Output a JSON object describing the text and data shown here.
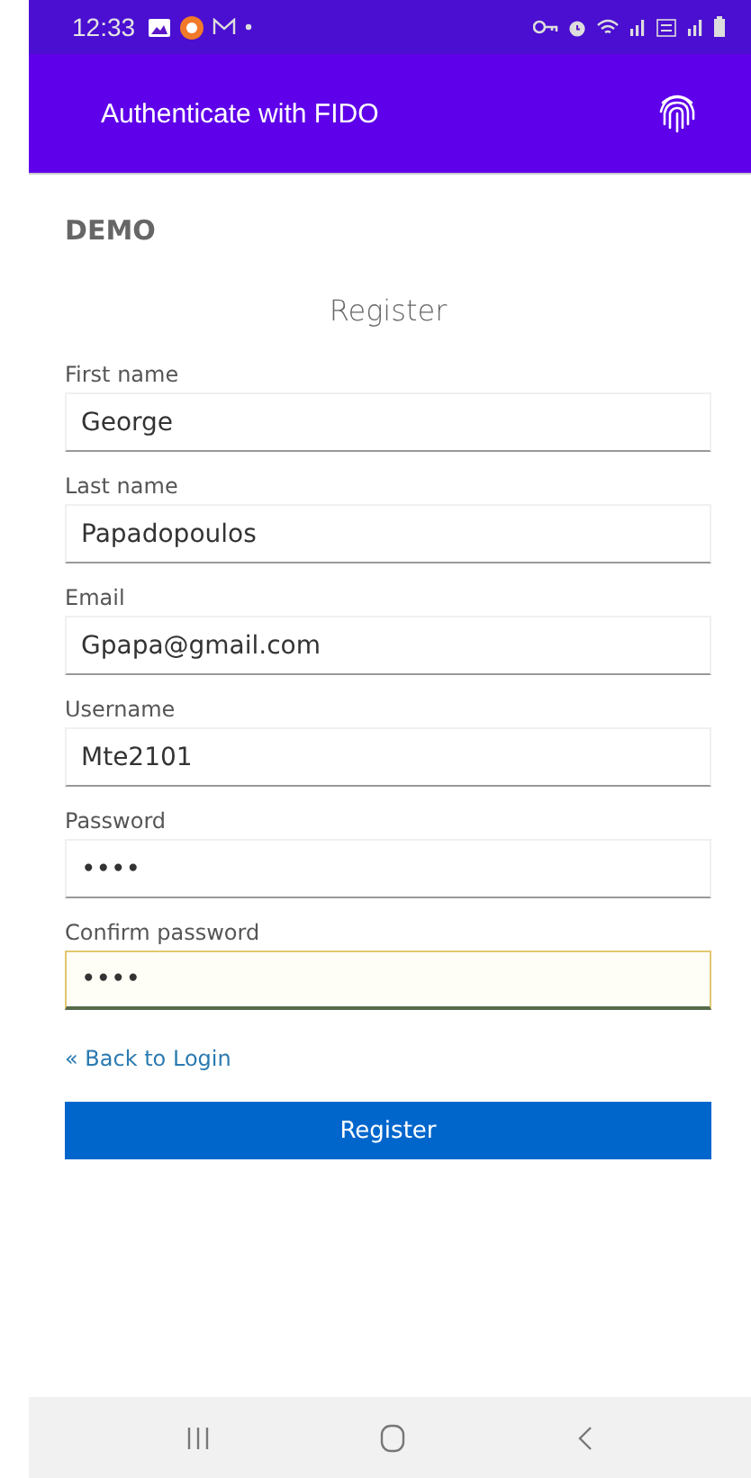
{
  "status_bar": {
    "time": "12:33"
  },
  "app_bar": {
    "title": "Authenticate with FIDO"
  },
  "brand": "DEMO",
  "form": {
    "title": "Register",
    "fields": [
      {
        "label": "First name",
        "value": "George",
        "focused": false
      },
      {
        "label": "Last name",
        "value": "Papadopoulos",
        "focused": false
      },
      {
        "label": "Email",
        "value": "Gpapa@gmail.com",
        "focused": false
      },
      {
        "label": "Username",
        "value": "Mte2101",
        "focused": false
      },
      {
        "label": "Password",
        "value": "••••",
        "focused": false
      },
      {
        "label": "Confirm password",
        "value": "••••",
        "focused": true
      }
    ],
    "back_link": "« Back to Login",
    "submit": "Register"
  }
}
